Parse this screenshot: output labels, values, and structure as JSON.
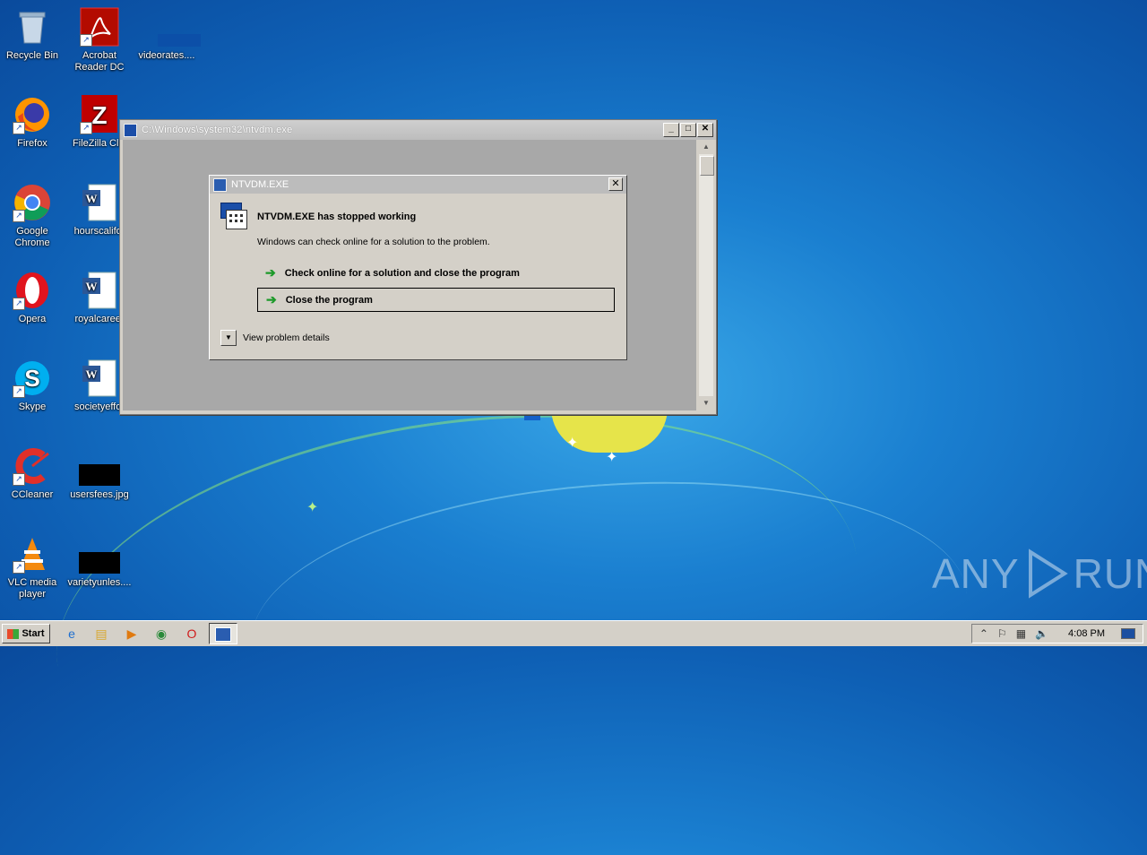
{
  "desktop": {
    "icons": [
      {
        "label": "Recycle Bin"
      },
      {
        "label": "Acrobat\nReader DC"
      },
      {
        "label": "videorates...."
      },
      {
        "label": "Firefox"
      },
      {
        "label": "FileZilla Clie"
      },
      {
        "label": "Google\nChrome"
      },
      {
        "label": "hourscalifor"
      },
      {
        "label": "Opera"
      },
      {
        "label": "royalcareer"
      },
      {
        "label": "Skype"
      },
      {
        "label": "societyeffor"
      },
      {
        "label": "CCleaner"
      },
      {
        "label": "usersfees.jpg"
      },
      {
        "label": "VLC media\nplayer"
      },
      {
        "label": "varietyunles...."
      }
    ]
  },
  "ntvdm_window": {
    "title": "C:\\Windows\\system32\\ntvdm.exe"
  },
  "dialog": {
    "title": "NTVDM.EXE",
    "heading": "NTVDM.EXE has stopped working",
    "subtext": "Windows can check online for a solution to the problem.",
    "option_check_online": "Check online for a solution and close the program",
    "option_close": "Close the program",
    "details": "View problem details"
  },
  "taskbar": {
    "start_label": "Start",
    "clock": "4:08 PM",
    "tray_icons": [
      "chevron-up-icon",
      "action-center-flag-icon",
      "network-icon",
      "volume-icon"
    ],
    "pinned_icons": [
      "internet-explorer-icon",
      "file-explorer-icon",
      "media-player-icon",
      "chrome-icon",
      "opera-icon",
      "ntvdm-icon"
    ]
  },
  "watermark": {
    "left": "ANY",
    "right": "RUN"
  },
  "colors": {
    "desktop_blue": "#1a7fd0",
    "dialog_gray": "#d4d0c8",
    "arrow_green": "#1d9a2a"
  }
}
